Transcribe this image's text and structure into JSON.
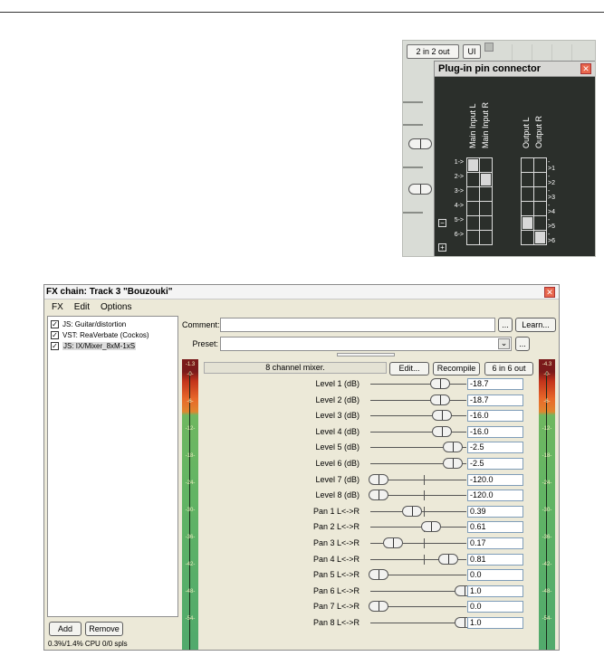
{
  "pin_connector": {
    "io_label": "2 in 2 out",
    "ui_label": "UI",
    "title": "Plug-in pin connector",
    "input_labels": [
      "Main Input L",
      "Main Input R"
    ],
    "output_labels": [
      "Output L",
      "Output R"
    ],
    "in_rows": [
      "1->",
      "2->",
      "3->",
      "4->",
      "5->",
      "6->"
    ],
    "out_rows": [
      "->1",
      "->2",
      "->3",
      "->4",
      "->5",
      "->6"
    ],
    "minus": "−",
    "plus": "+",
    "input_matrix": [
      [
        1,
        0
      ],
      [
        0,
        1
      ],
      [
        0,
        0
      ],
      [
        0,
        0
      ],
      [
        0,
        0
      ],
      [
        0,
        0
      ]
    ],
    "output_matrix": [
      [
        0,
        0
      ],
      [
        0,
        0
      ],
      [
        0,
        0
      ],
      [
        0,
        0
      ],
      [
        1,
        0
      ],
      [
        0,
        1
      ]
    ]
  },
  "fx_chain": {
    "title": "FX chain: Track 3 \"Bouzouki\"",
    "menu": [
      "FX",
      "Edit",
      "Options"
    ],
    "plugins": [
      {
        "name": "JS: Guitar/distortion",
        "checked": true
      },
      {
        "name": "VST: ReaVerbate (Cockos)",
        "checked": true
      },
      {
        "name": "JS: IX/Mixer_8xM-1xS",
        "checked": true,
        "selected": true
      }
    ],
    "add_label": "Add",
    "remove_label": "Remove",
    "cpu_status": "0.3%/1.4% CPU 0/0 spls",
    "comment_label": "Comment:",
    "comment_value": "",
    "preset_label": "Preset:",
    "preset_value": "",
    "ellipsis": "...",
    "learn_label": "Learn...",
    "dropdown_arrow": "⌄",
    "description": "8 channel mixer.",
    "edit_label": "Edit...",
    "recompile_label": "Recompile",
    "io_label": "6 in 6 out",
    "vu_left_peak": "-1.3",
    "vu_right_peak": "-4.3",
    "vu_scale": [
      "-0-",
      "-6-",
      "-12-",
      "-18-",
      "-24-",
      "-30-",
      "-36-",
      "-42-",
      "-48-",
      "-54-"
    ],
    "params": [
      {
        "label": "Level 1 (dB)",
        "value": "-18.7",
        "fraction": 0.72,
        "center_tick": false
      },
      {
        "label": "Level 2 (dB)",
        "value": "-18.7",
        "fraction": 0.72,
        "center_tick": false
      },
      {
        "label": "Level 3 (dB)",
        "value": "-16.0",
        "fraction": 0.74,
        "center_tick": false
      },
      {
        "label": "Level 4 (dB)",
        "value": "-16.0",
        "fraction": 0.74,
        "center_tick": false
      },
      {
        "label": "Level 5 (dB)",
        "value": "-2.5",
        "fraction": 0.86,
        "center_tick": false
      },
      {
        "label": "Level 6 (dB)",
        "value": "-2.5",
        "fraction": 0.86,
        "center_tick": false
      },
      {
        "label": "Level 7 (dB)",
        "value": "-120.0",
        "fraction": 0.0,
        "center_tick": true
      },
      {
        "label": "Level 8 (dB)",
        "value": "-120.0",
        "fraction": 0.0,
        "center_tick": true
      },
      {
        "label": "Pan 1 L<->R",
        "value": "0.39",
        "fraction": 0.39,
        "center_tick": true
      },
      {
        "label": "Pan 2 L<->R",
        "value": "0.61",
        "fraction": 0.61,
        "center_tick": true
      },
      {
        "label": "Pan 3 L<->R",
        "value": "0.17",
        "fraction": 0.17,
        "center_tick": true
      },
      {
        "label": "Pan 4 L<->R",
        "value": "0.81",
        "fraction": 0.81,
        "center_tick": true
      },
      {
        "label": "Pan 5 L<->R",
        "value": "0.0",
        "fraction": 0.0,
        "center_tick": false
      },
      {
        "label": "Pan 6 L<->R",
        "value": "1.0",
        "fraction": 1.0,
        "center_tick": false
      },
      {
        "label": "Pan 7 L<->R",
        "value": "0.0",
        "fraction": 0.0,
        "center_tick": false
      },
      {
        "label": "Pan 8 L<->R",
        "value": "1.0",
        "fraction": 1.0,
        "center_tick": false
      }
    ],
    "colors": {
      "vu_top": "#7a1a1a",
      "vu_hot": "#e8692a",
      "vu_green": "#62b464",
      "close": "#e8674d"
    }
  }
}
